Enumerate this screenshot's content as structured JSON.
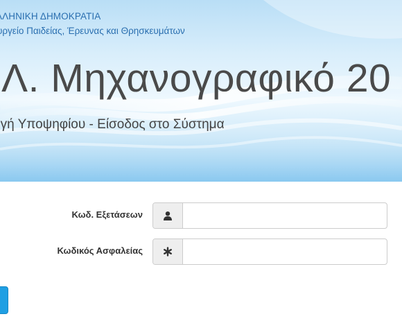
{
  "header": {
    "gov_line1": "ΛΛΗΝΙΚΗ ΔΗΜΟΚΡΑΤΙΑ",
    "gov_line2": "υργείο Παιδείας, Έρευνας και Θρησκευμάτων",
    "title": "Λ. Μηχανογραφικό 20",
    "subtitle": "ογή Υποψηφίου - Είσοδος στο Σύστημα"
  },
  "form": {
    "exam_code": {
      "label": "Κωδ. Εξετάσεων",
      "icon": "user-icon",
      "value": ""
    },
    "security_code": {
      "label": "Κωδικός Ασφαλείας",
      "icon": "asterisk-icon",
      "value": ""
    }
  },
  "colors": {
    "banner_blue": "#9fd2f2",
    "gov_text": "#2a6fb0",
    "button_blue": "#1f9fe3"
  }
}
